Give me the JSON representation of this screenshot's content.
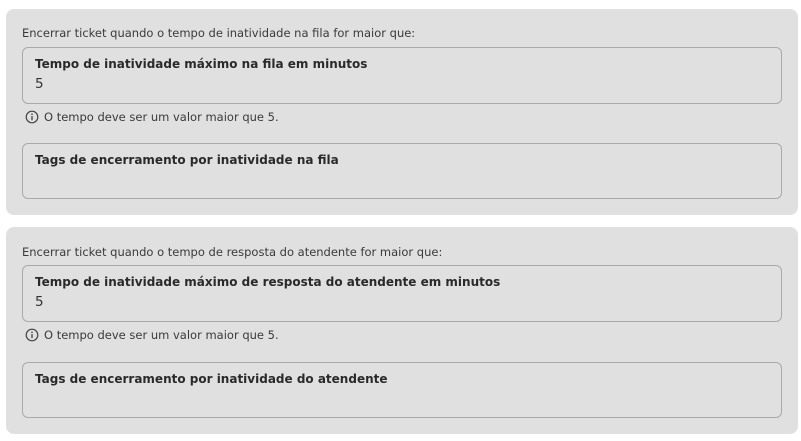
{
  "inactivity_queue": {
    "caption": "Encerrar ticket quando o tempo de inatividade na fila for maior que:",
    "minutes_field": {
      "label": "Tempo de inatividade máximo na fila em minutos",
      "value": "5"
    },
    "hint": "O tempo deve ser um valor maior que 5.",
    "tags_field": {
      "label": "Tags de encerramento por inatividade na fila"
    }
  },
  "inactivity_agent": {
    "caption": "Encerrar ticket quando o tempo de resposta do atendente for maior que:",
    "minutes_field": {
      "label": "Tempo de inatividade máximo de resposta do atendente em minutos",
      "value": "5"
    },
    "hint": "O tempo deve ser um valor maior que 5.",
    "tags_field": {
      "label": "Tags de encerramento por inatividade do atendente"
    }
  },
  "icons": {
    "hint_icon": "info-circle-icon"
  },
  "colors": {
    "card_background": "#e0e0e0",
    "field_border": "#a9a9a9",
    "text": "#333333"
  }
}
